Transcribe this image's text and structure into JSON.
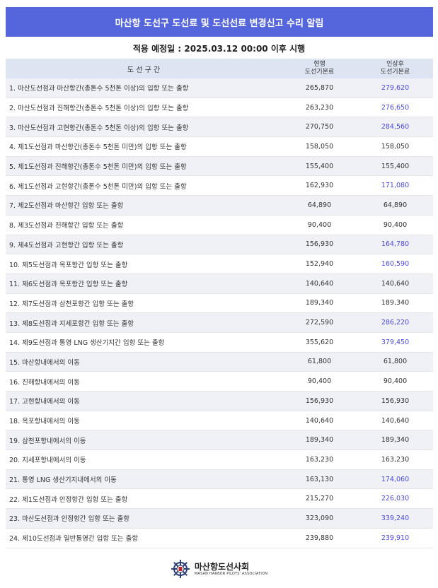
{
  "header": {
    "title": "마산항 도선구 도선료 및 도선선료 변경신고 수리 알림"
  },
  "subtitle": "적용 예정일 : 2025.03.12  00:00 이후 시행",
  "table": {
    "col_section": "도 선 구 간",
    "col_current_1": "현행",
    "col_current_2": "도선기본료",
    "col_new_1": "인상후",
    "col_new_2": "도선기본료",
    "rows": [
      {
        "label": "1. 마산도선점과 마산항간(총톤수 5천톤 이상)의 입항 또는 출항",
        "current": "265,870",
        "new": "279,620",
        "changed": true
      },
      {
        "label": "2. 마산도선점과 진해항간(총톤수 5천톤 이상)의 입항 또는 출항",
        "current": "263,230",
        "new": "276,650",
        "changed": true
      },
      {
        "label": "3. 마산도선점과 고현항간(총톤수 5천톤 이상)의 입항 또는 출항",
        "current": "270,750",
        "new": "284,560",
        "changed": true
      },
      {
        "label": "4. 제1도선점과 마산항간(총톤수 5천톤 미만)의 입항 또는 출항",
        "current": "158,050",
        "new": "158,050",
        "changed": false
      },
      {
        "label": "5. 제1도선점과 진해항간(총톤수 5천톤 미만)의 입항 또는 출항",
        "current": "155,400",
        "new": "155,400",
        "changed": false
      },
      {
        "label": "6. 제1도선점과 고현항간(총톤수 5천톤 미만)의 입항 또는 출항",
        "current": "162,930",
        "new": "171,080",
        "changed": true
      },
      {
        "label": "7. 제2도선점과 마산항간 입항 또는 출항",
        "current": "64,890",
        "new": "64,890",
        "changed": false
      },
      {
        "label": "8. 제3도선점과 진해항간 입항 또는 출항",
        "current": "90,400",
        "new": "90,400",
        "changed": false
      },
      {
        "label": "9. 제4도선점과 고현항간 입항 또는 출항",
        "current": "156,930",
        "new": "164,780",
        "changed": true
      },
      {
        "label": "10. 제5도선점과 옥포항간 입항 또는 출항",
        "current": "152,940",
        "new": "160,590",
        "changed": true
      },
      {
        "label": "11. 제6도선점과 옥포항간 입항 또는 출항",
        "current": "140,640",
        "new": "140,640",
        "changed": false
      },
      {
        "label": "12. 제7도선점과 삼천포항간 입항 또는 출항",
        "current": "189,340",
        "new": "189,340",
        "changed": false
      },
      {
        "label": "13. 제8도선점과 지세포항간 입항 또는 출항",
        "current": "272,590",
        "new": "286,220",
        "changed": true
      },
      {
        "label": "14. 제9도선점과 통영 LNG 생산기지간 입항 또는 출항",
        "current": "355,620",
        "new": "379,450",
        "changed": true
      },
      {
        "label": "15. 마산항내에서의 이동",
        "current": "61,800",
        "new": "61,800",
        "changed": false
      },
      {
        "label": "16. 진해항내에서의 이동",
        "current": "90,400",
        "new": "90,400",
        "changed": false
      },
      {
        "label": "17. 고현항내에서의 이동",
        "current": "156,930",
        "new": "156,930",
        "changed": false
      },
      {
        "label": "18. 옥포항내에서의 이동",
        "current": "140,640",
        "new": "140,640",
        "changed": false
      },
      {
        "label": "19. 삼천포항내에서의 이동",
        "current": "189,340",
        "new": "189,340",
        "changed": false
      },
      {
        "label": "20. 지세포항내에서의 이동",
        "current": "163,230",
        "new": "163,230",
        "changed": false
      },
      {
        "label": "21. 통영 LNG 생산기지내에서의 이동",
        "current": "163,130",
        "new": "174,060",
        "changed": true
      },
      {
        "label": "22. 제1도선점과 안정항간 입항 또는 출항",
        "current": "215,270",
        "new": "226,030",
        "changed": true
      },
      {
        "label": "23. 마산도선점과 안정항간 입항 또는 출항",
        "current": "323,090",
        "new": "339,240",
        "changed": true
      },
      {
        "label": "24. 제10도선점과 일반통영간 입항 또는 출항",
        "current": "239,880",
        "new": "239,910",
        "changed": true
      }
    ]
  },
  "footer": {
    "org_name": "마산항도선사회",
    "org_name_en": "MASAN HARBOR PILOTS' ASSOCIATION",
    "logo_icon": "ship-wheel-icon"
  },
  "colors": {
    "header_bg": "#5566dd",
    "table_header_bg": "#dde4f2",
    "row_alt_bg": "#eff1f6",
    "changed_value": "#4a4ae0"
  }
}
